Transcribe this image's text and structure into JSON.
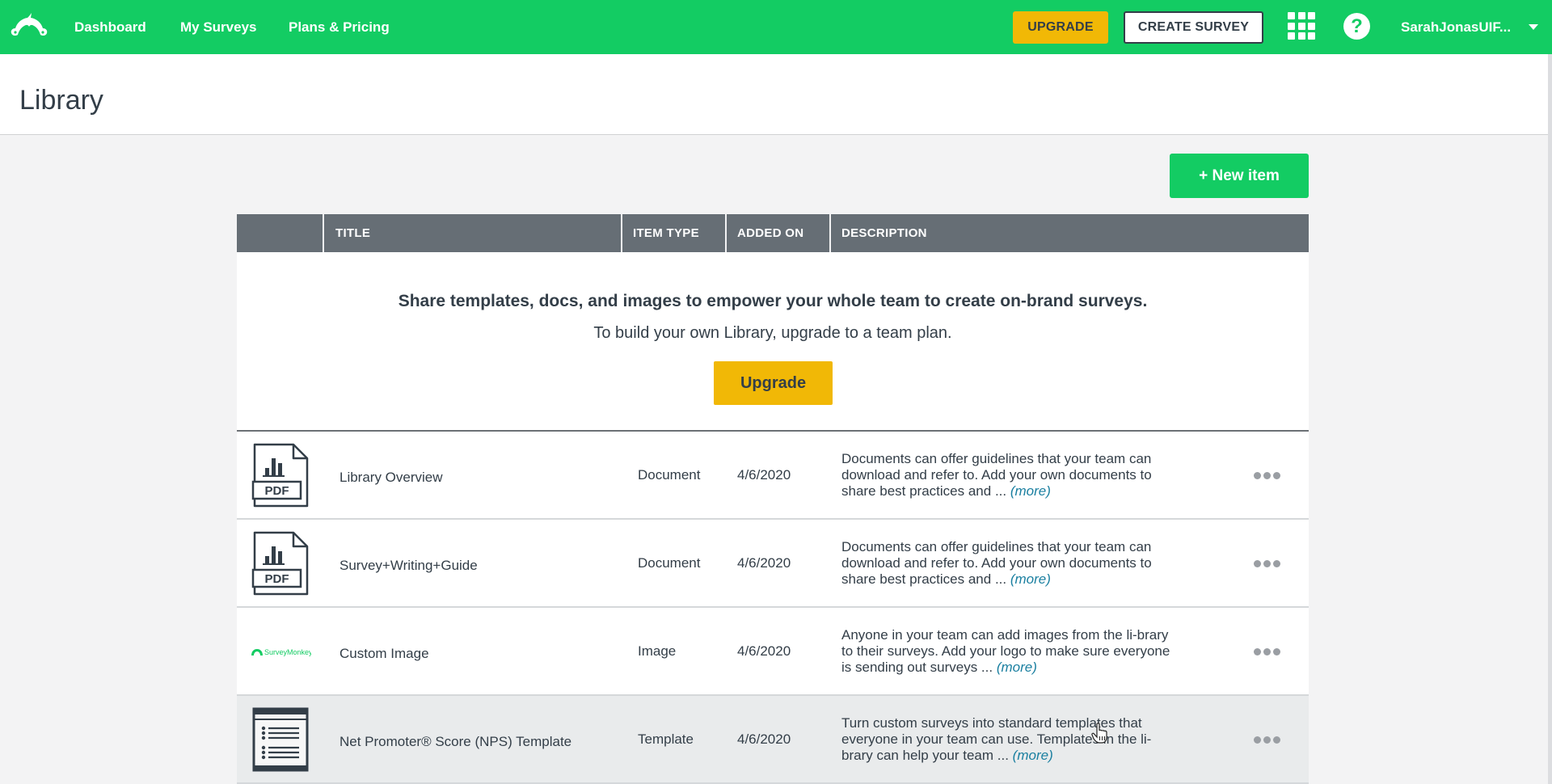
{
  "nav": {
    "logo": "surveymonkey-logo",
    "links": [
      "Dashboard",
      "My Surveys",
      "Plans & Pricing"
    ],
    "upgrade_label": "UPGRADE",
    "create_survey_label": "CREATE SURVEY",
    "apps_icon": "apps-grid-icon",
    "help_icon_glyph": "?",
    "user_name": "SarahJonasUIF..."
  },
  "page": {
    "title": "Library",
    "new_item_label": "+ New item"
  },
  "table": {
    "columns": [
      "",
      "TITLE",
      "ITEM TYPE",
      "ADDED ON",
      "DESCRIPTION"
    ],
    "promo": {
      "headline": "Share templates, docs, and images to empower your whole team to create on-brand surveys.",
      "subtext": "To build your own Library, upgrade to a team plan.",
      "button_label": "Upgrade"
    },
    "rows": [
      {
        "icon": "pdf-document-icon",
        "title": "Library Overview",
        "type": "Document",
        "added": "4/6/2020",
        "description": "Documents can offer guidelines that your team can download and refer to. Add your own documents to share best practices and ...",
        "more": "(more)"
      },
      {
        "icon": "pdf-document-icon",
        "title": "Survey+Writing+Guide",
        "type": "Document",
        "added": "4/6/2020",
        "description": "Documents can offer guidelines that your team can download and refer to. Add your own documents to share best practices and ...",
        "more": "(more)"
      },
      {
        "icon": "surveymonkey-image-thumbnail",
        "thumbnail_text": "SurveyMonkey",
        "title": "Custom Image",
        "type": "Image",
        "added": "4/6/2020",
        "description": "Anyone in your team can add images from the li-brary to their surveys. Add your logo to make sure everyone is sending out surveys ...",
        "more": "(more)"
      },
      {
        "icon": "template-list-icon",
        "title": "Net Promoter® Score (NPS) Template",
        "type": "Template",
        "added": "4/6/2020",
        "description": "Turn custom surveys into standard templates that everyone in your team can use. Templates in the li-brary can help your team ...",
        "more": "(more)"
      }
    ]
  },
  "colors": {
    "brand_green": "#13cc63",
    "upgrade_yellow": "#f1b806",
    "header_gray": "#666e75",
    "link_teal": "#1a7fa0"
  }
}
